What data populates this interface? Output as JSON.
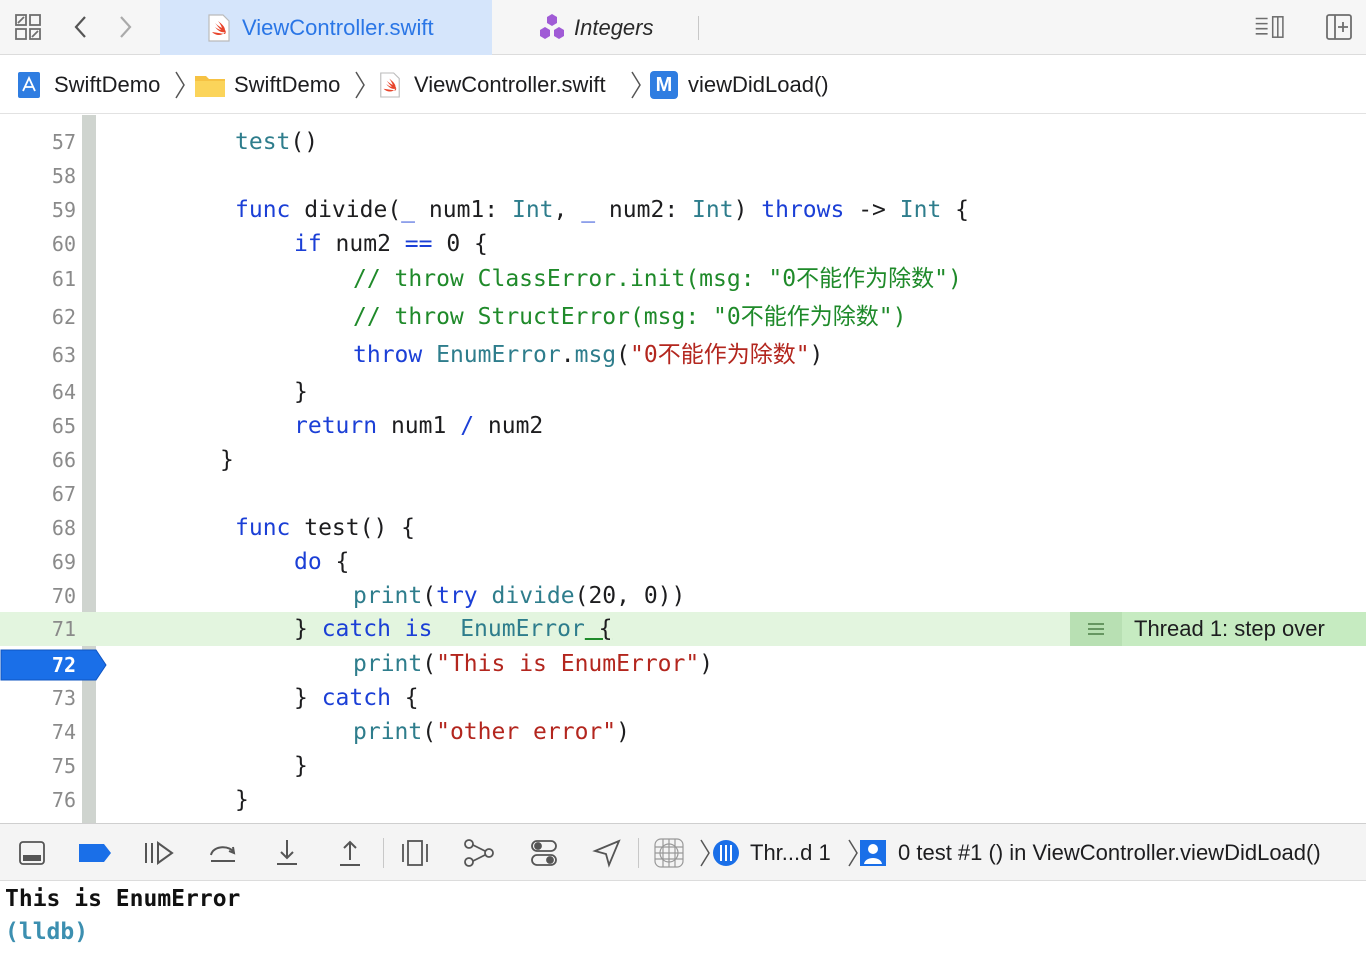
{
  "tabs": [
    {
      "label": "ViewController.swift",
      "icon": "swift-file-icon",
      "active": true
    },
    {
      "label": "Integers",
      "icon": "hexagon-cluster-icon",
      "active": false
    }
  ],
  "breadcrumb": [
    {
      "label": "SwiftDemo",
      "icon": "xcode-project-icon"
    },
    {
      "label": "SwiftDemo",
      "icon": "folder-icon"
    },
    {
      "label": "ViewController.swift",
      "icon": "swift-file-icon"
    },
    {
      "label": "viewDidLoad()",
      "icon": "method-icon",
      "badge": "M"
    }
  ],
  "editor": {
    "lines": [
      {
        "num": "57",
        "html_key": "l57"
      },
      {
        "num": "58"
      },
      {
        "num": "59"
      },
      {
        "num": "60"
      },
      {
        "num": "61"
      },
      {
        "num": "62"
      },
      {
        "num": "63"
      },
      {
        "num": "64"
      },
      {
        "num": "65"
      },
      {
        "num": "66"
      },
      {
        "num": "67"
      },
      {
        "num": "68"
      },
      {
        "num": "69"
      },
      {
        "num": "70"
      },
      {
        "num": "71"
      },
      {
        "num": "72"
      },
      {
        "num": "73"
      },
      {
        "num": "74"
      },
      {
        "num": "75"
      },
      {
        "num": "76"
      }
    ],
    "code": {
      "l57_a": "test",
      "l57_b": "()",
      "l59_func": "func",
      "l59_name": " divide(",
      "l59_us1": "_",
      "l59_p1": " num1: ",
      "l59_int1": "Int",
      "l59_comma": ", ",
      "l59_us2": "_",
      "l59_p2": " num2: ",
      "l59_int2": "Int",
      "l59_close": ") ",
      "l59_throws": "throws",
      "l59_arrow": " -> ",
      "l59_int3": "Int",
      "l59_brace": " {",
      "l60_if": "if",
      "l60_a": " num2 ",
      "l60_eq": "==",
      "l60_b": " 0 {",
      "l61": "// throw ClassError.init(msg: \"0不能作为除数\")",
      "l62": "// throw StructError(msg: \"0不能作为除数\")",
      "l63_throw": "throw",
      "l63_type": " EnumError",
      "l63_dot": ".",
      "l63_msg": "msg",
      "l63_open": "(",
      "l63_str": "\"0不能作为除数\"",
      "l63_close": ")",
      "l64": "}",
      "l65_return": "return",
      "l65_a": " num1 ",
      "l65_div": "/",
      "l65_b": " num2",
      "l66": "}",
      "l68_func": "func",
      "l68_rest": " test() {",
      "l69_do": "do",
      "l69_rest": " {",
      "l70_print": "print",
      "l70_open": "(",
      "l70_try": "try",
      "l70_divide": " divide",
      "l70_rest": "(20, 0))",
      "l71_a": "} ",
      "l71_catch": "catch",
      "l71_is": " is",
      "l71_type": "  EnumError",
      "l71_brace": " {",
      "l72_print": "print",
      "l72_open": "(",
      "l72_str": "\"This is EnumError\"",
      "l72_close": ")",
      "l73_a": "} ",
      "l73_catch": "catch",
      "l73_rest": " {",
      "l74_print": "print",
      "l74_open": "(",
      "l74_str": "\"other error\"",
      "l74_close": ")",
      "l75": "}",
      "l76": "}"
    },
    "current_line_number": "72",
    "thread_annotation": "Thread 1: step over"
  },
  "debugbar": {
    "thread_label": "Thr...d 1",
    "frame_label": "0 test #1 () in ViewController.viewDidLoad()"
  },
  "console": {
    "output": "This is EnumError",
    "prompt": "(lldb)"
  },
  "colors": {
    "keyword": "#1b3fd6",
    "type": "#2e7d8c",
    "string": "#b3261e",
    "comment": "#1f8a2a",
    "active_tab_bg": "#d5e5fb",
    "highlight_line": "#e3f5df",
    "breakpoint_blue": "#1a6fe8"
  }
}
